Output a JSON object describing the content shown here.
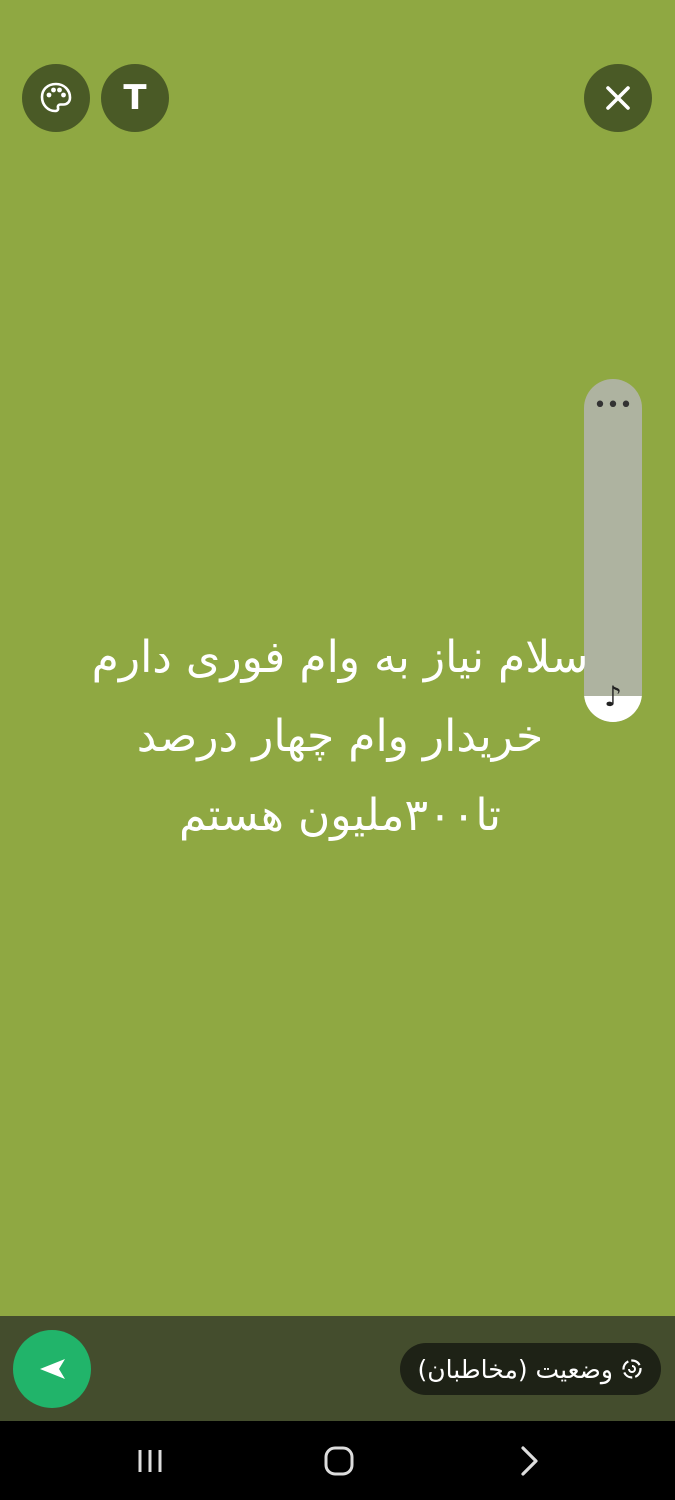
{
  "toolbar": {
    "palette_icon": "palette-icon",
    "text_label": "T",
    "close_icon": "close-icon"
  },
  "status": {
    "text": "سلام نیاز به وام فوری دارم\nخریدار وام چهار درصد\nتا۳۰۰ملیون هستم",
    "background_color": "#8fa842",
    "text_color": "#ffffff"
  },
  "font_slider": {
    "more_icon": "more-dots-icon",
    "dots": "•••",
    "note_icon": "music-note-icon",
    "note_glyph": "♪"
  },
  "composer": {
    "audience_label": "وضعیت (مخاطبان)",
    "audience_icon": "status-ring-icon",
    "send_icon": "send-arrow-icon",
    "accent_color": "#21b46a"
  },
  "system_nav": {
    "recents_icon": "recents-icon",
    "home_icon": "home-icon",
    "back_icon": "back-chevron-icon"
  }
}
